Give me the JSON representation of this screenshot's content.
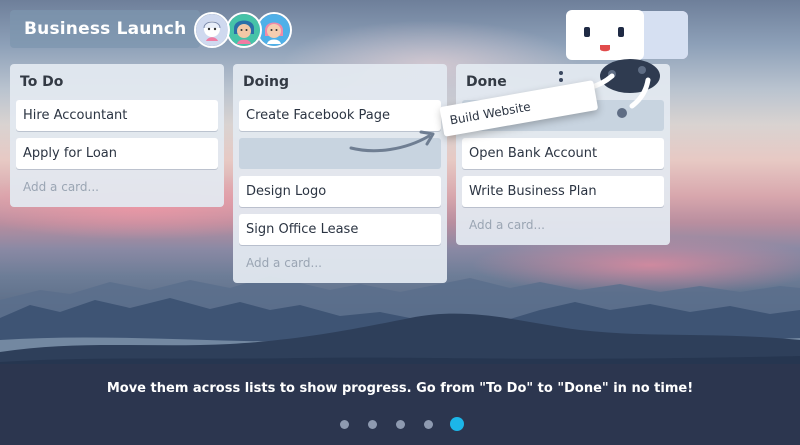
{
  "board": {
    "title": "Business Launch",
    "members": [
      {
        "avatar": "member-avatar-1",
        "color": "#cfd9ef"
      },
      {
        "avatar": "member-avatar-2",
        "color": "#46c3a8"
      },
      {
        "avatar": "member-avatar-3",
        "color": "#4fb0e8"
      }
    ]
  },
  "lists": [
    {
      "title": "To Do",
      "cards": [
        "Hire Accountant",
        "Apply for Loan"
      ],
      "add_card": "Add a card..."
    },
    {
      "title": "Doing",
      "cards": [
        "Create Facebook Page",
        "Design Logo",
        "Sign Office Lease"
      ],
      "add_card": "Add a card..."
    },
    {
      "title": "Done",
      "cards": [
        "Open Bank Account",
        "Write Business Plan"
      ],
      "add_card": "Add a card..."
    }
  ],
  "dragging": {
    "card": "Build Website"
  },
  "caption": "Move them across lists to show progress. Go from \"To Do\" to \"Done\" in no time!",
  "pagination": {
    "total": 5,
    "active": 5
  },
  "colors": {
    "accent": "#1cb6e8",
    "list_bg": "#e2e9f0",
    "placeholder": "#c8d4e0",
    "band": "#2d374e"
  }
}
